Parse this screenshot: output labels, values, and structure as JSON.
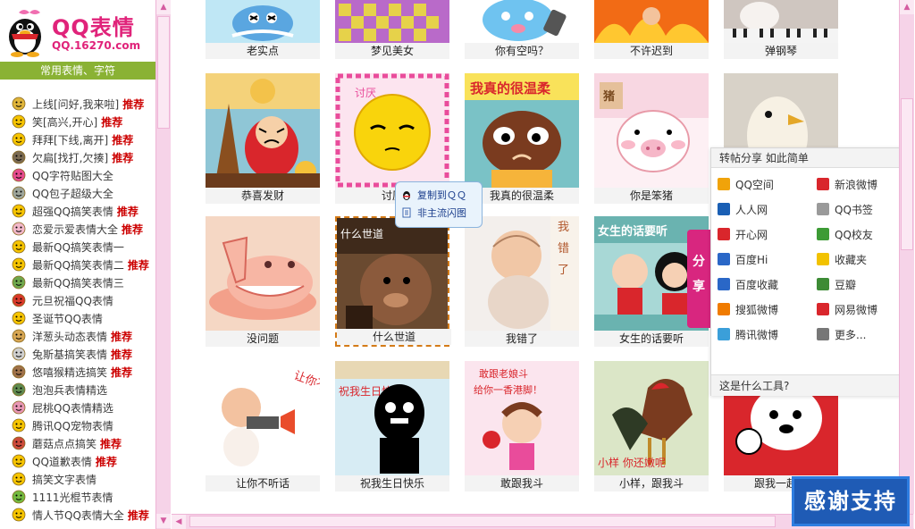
{
  "logo": {
    "title": "QQ表情",
    "url": "QQ.16270.com"
  },
  "sidebar": {
    "heading": "常用表情、字符",
    "items": [
      {
        "label": "上线[问好,我来啦]",
        "rec": "推荐",
        "color": "#e0b53b"
      },
      {
        "label": "笑[高兴,开心]",
        "rec": "推荐",
        "color": "#f6c400"
      },
      {
        "label": "拜拜[下线,离开]",
        "rec": "推荐",
        "color": "#f6c400"
      },
      {
        "label": "欠扁[找打,欠揍]",
        "rec": "推荐",
        "color": "#7a6a52"
      },
      {
        "label": "QQ字符贴图大全",
        "rec": "",
        "color": "#e64b8e"
      },
      {
        "label": "QQ包子超级大全",
        "rec": "",
        "color": "#9ea59a"
      },
      {
        "label": "超强QQ搞笑表情",
        "rec": "推荐",
        "color": "#f6c400"
      },
      {
        "label": "恋爱示爱表情大全",
        "rec": "推荐",
        "color": "#f2b7c9"
      },
      {
        "label": "最新QQ搞笑表情一",
        "rec": "",
        "color": "#f6c400"
      },
      {
        "label": "最新QQ搞笑表情二",
        "rec": "推荐",
        "color": "#f6c400"
      },
      {
        "label": "最新QQ搞笑表情三",
        "rec": "",
        "color": "#6fa84d"
      },
      {
        "label": "元旦祝福QQ表情",
        "rec": "",
        "color": "#d9392a"
      },
      {
        "label": "圣诞节QQ表情",
        "rec": "",
        "color": "#f6c400"
      },
      {
        "label": "洋葱头动态表情",
        "rec": "推荐",
        "color": "#d7a653"
      },
      {
        "label": "兔斯基搞笑表情",
        "rec": "推荐",
        "color": "#cfcfcf"
      },
      {
        "label": "悠嘻猴精选搞笑",
        "rec": "推荐",
        "color": "#a0724a"
      },
      {
        "label": "泡泡兵表情精选",
        "rec": "",
        "color": "#5f8a4f"
      },
      {
        "label": "屁桃QQ表情精选",
        "rec": "",
        "color": "#e896b4"
      },
      {
        "label": "腾讯QQ宠物表情",
        "rec": "",
        "color": "#f6c400"
      },
      {
        "label": "蘑菇点点搞笑",
        "rec": "推荐",
        "color": "#cc4b3b"
      },
      {
        "label": "QQ道歉表情",
        "rec": "推荐",
        "color": "#f6c400"
      },
      {
        "label": "搞笑文字表情",
        "rec": "",
        "color": "#f6c400"
      },
      {
        "label": "1111光棍节表情",
        "rec": "",
        "color": "#73b93f"
      },
      {
        "label": "情人节QQ表情大全",
        "rec": "推荐",
        "color": "#f6c400"
      }
    ]
  },
  "grid": {
    "top_row": [
      "老实点",
      "梦见美女",
      "你有空吗？",
      "不许迟到",
      "弹钢琴"
    ],
    "rows": [
      [
        "恭喜发财",
        "讨厌",
        "我真的很温柔",
        "你是笨猪",
        ""
      ],
      [
        "没问题",
        "什么世道",
        "我错了",
        "女生的话要听"
      ],
      [
        "让你不听话",
        "祝我生日快乐",
        "敢跟我斗",
        "小样，跟我斗",
        "跟我一起来"
      ]
    ],
    "texts": {
      "taoyan": "讨厌",
      "wozhende": "我真的很温柔",
      "zhu": "猪",
      "shenme": "什么世道",
      "wo": "我",
      "cuo": "错",
      "le": "了",
      "nvsheng": "女生的话要听",
      "rangni": "让你不听话",
      "zhuwo": "祝我生日快乐",
      "ganshang": "敢跟老娘斗",
      "geiyixiang": "给你一香港脚！",
      "xiaoyang": "小样 你还嫩呢"
    }
  },
  "tooltip": {
    "copy": "复制到ＱＱ",
    "flash": "非主流闪图"
  },
  "share": {
    "tab": "分享",
    "title": "转帖分享 如此简单",
    "items": [
      {
        "label": "QQ空间",
        "color": "#f0a30a"
      },
      {
        "label": "新浪微博",
        "color": "#d9262c"
      },
      {
        "label": "人人网",
        "color": "#1a5fb4"
      },
      {
        "label": "QQ书签",
        "color": "#9a9a9a"
      },
      {
        "label": "开心网",
        "color": "#d9262c"
      },
      {
        "label": "QQ校友",
        "color": "#3d9b35"
      },
      {
        "label": "百度Hi",
        "color": "#2a67c7"
      },
      {
        "label": "收藏夹",
        "color": "#f2c200"
      },
      {
        "label": "百度收藏",
        "color": "#2a67c7"
      },
      {
        "label": "豆瓣",
        "color": "#3d8b35"
      },
      {
        "label": "搜狐微博",
        "color": "#f07b00"
      },
      {
        "label": "网易微博",
        "color": "#d9262c"
      },
      {
        "label": "腾讯微博",
        "color": "#3b9fd9"
      },
      {
        "label": "更多...",
        "color": "#777777"
      }
    ],
    "footer": "这是什么工具?"
  },
  "thanks": "感谢支持"
}
